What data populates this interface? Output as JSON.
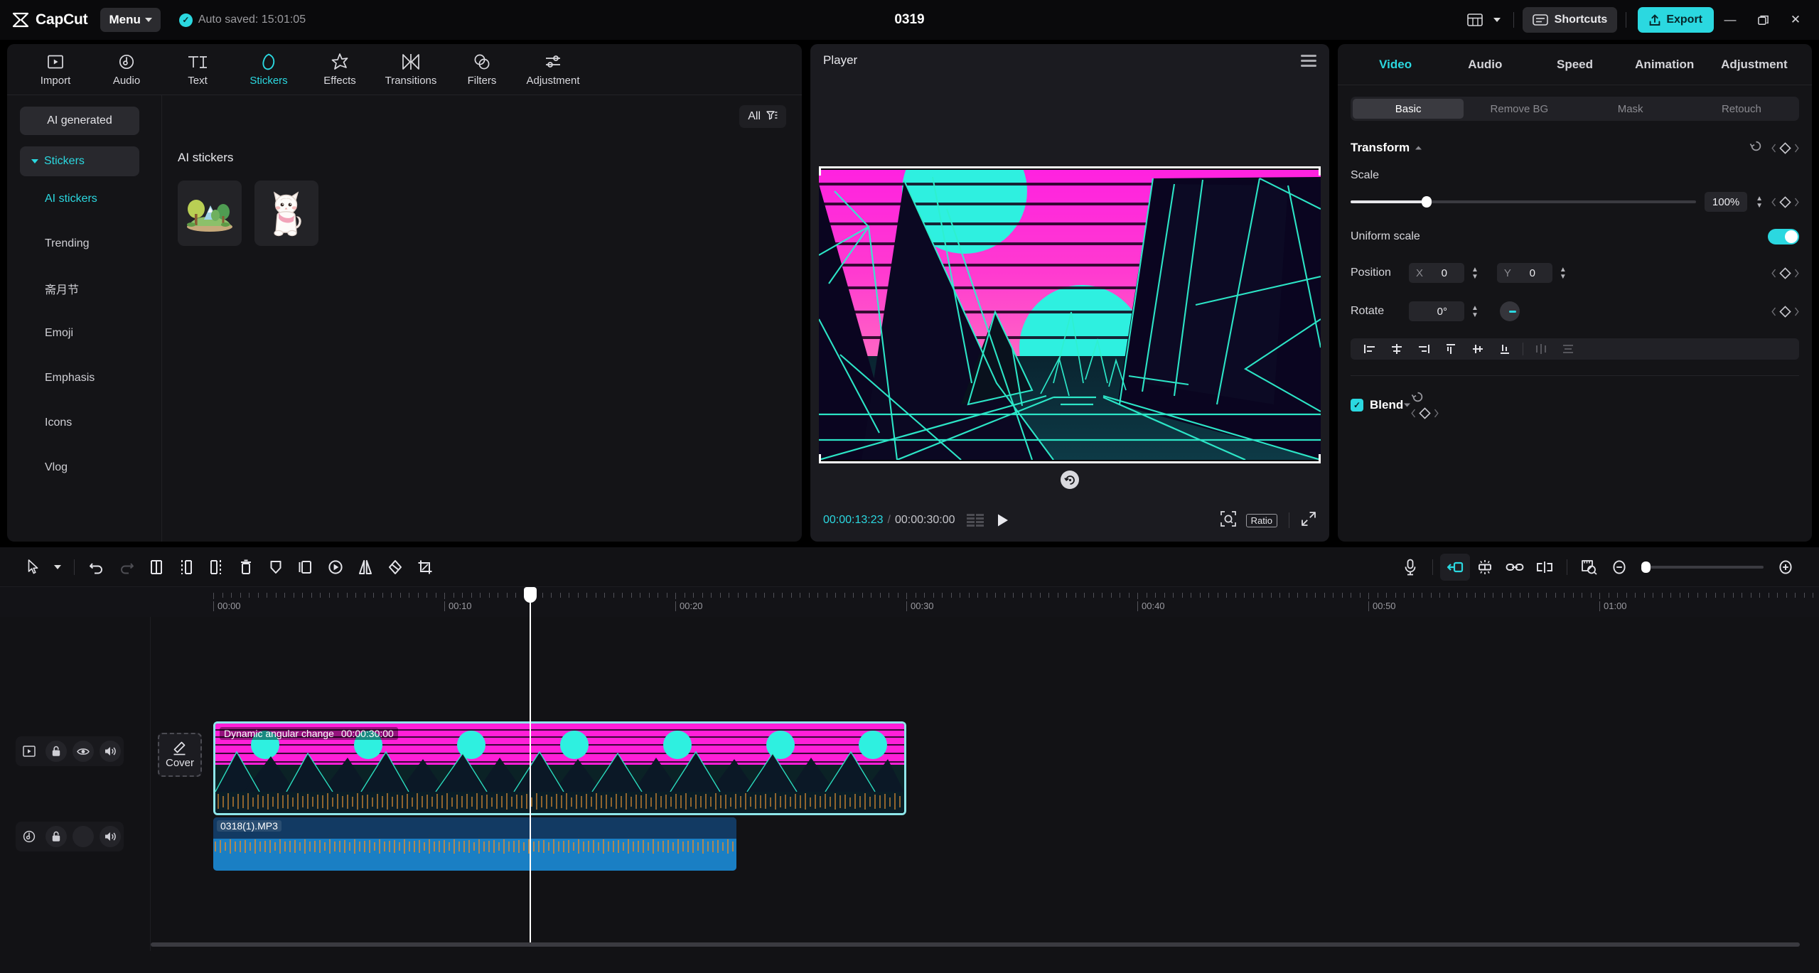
{
  "app": {
    "brand": "CapCut",
    "menu_label": "Menu",
    "autosave": "Auto saved: 15:01:05",
    "project_title": "0319",
    "shortcuts_label": "Shortcuts",
    "export_label": "Export",
    "accent": "#2bd8e0"
  },
  "left_panel": {
    "tabs": [
      {
        "label": "Import",
        "icon": "import-icon",
        "active": false
      },
      {
        "label": "Audio",
        "icon": "audio-icon",
        "active": false
      },
      {
        "label": "Text",
        "icon": "text-icon",
        "active": false
      },
      {
        "label": "Stickers",
        "icon": "stickers-icon",
        "active": true
      },
      {
        "label": "Effects",
        "icon": "effects-icon",
        "active": false
      },
      {
        "label": "Transitions",
        "icon": "transitions-icon",
        "active": false
      },
      {
        "label": "Filters",
        "icon": "filters-icon",
        "active": false
      },
      {
        "label": "Adjustment",
        "icon": "adjustment-icon",
        "active": false
      }
    ],
    "ai_generated_label": "AI generated",
    "group_label": "Stickers",
    "categories": [
      {
        "label": "AI stickers",
        "active": true
      },
      {
        "label": "Trending",
        "active": false
      },
      {
        "label": "斋月节",
        "active": false
      },
      {
        "label": "Emoji",
        "active": false
      },
      {
        "label": "Emphasis",
        "active": false
      },
      {
        "label": "Icons",
        "active": false
      },
      {
        "label": "Vlog",
        "active": false
      }
    ],
    "filter_label": "All",
    "section_title": "AI stickers",
    "stickers": [
      {
        "name": "forest-landscape-sticker"
      },
      {
        "name": "white-cat-sticker"
      }
    ]
  },
  "player": {
    "title": "Player",
    "current_time": "00:00:13:23",
    "time_separator": "/",
    "total_time": "00:00:30:00",
    "ratio_label": "Ratio"
  },
  "right_panel": {
    "tabs": [
      {
        "label": "Video",
        "active": true
      },
      {
        "label": "Audio",
        "active": false
      },
      {
        "label": "Speed",
        "active": false
      },
      {
        "label": "Animation",
        "active": false
      },
      {
        "label": "Adjustment",
        "active": false
      }
    ],
    "segments": [
      {
        "label": "Basic",
        "active": true
      },
      {
        "label": "Remove BG",
        "active": false
      },
      {
        "label": "Mask",
        "active": false
      },
      {
        "label": "Retouch",
        "active": false
      }
    ],
    "transform": {
      "title": "Transform",
      "scale_label": "Scale",
      "scale_value": "100%",
      "uniform_scale_label": "Uniform scale",
      "uniform_scale_on": true,
      "position_label": "Position",
      "position_x_key": "X",
      "position_x_value": "0",
      "position_y_key": "Y",
      "position_y_value": "0",
      "rotate_label": "Rotate",
      "rotate_value": "0°"
    },
    "blend": {
      "title": "Blend",
      "enabled": true
    }
  },
  "timeline": {
    "ruler_labels": [
      "00:00",
      "00:10",
      "00:20",
      "00:30",
      "00:40",
      "00:50",
      "01:00"
    ],
    "cover_label": "Cover",
    "video_clip": {
      "name": "Dynamic angular change",
      "duration": "00:00:30:00"
    },
    "audio_clip": {
      "name": "0318(1).MP3"
    }
  }
}
